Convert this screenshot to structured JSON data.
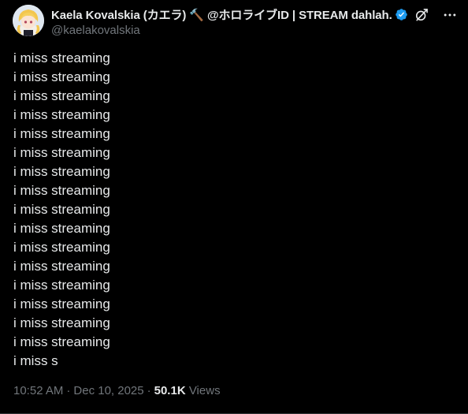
{
  "author": {
    "display_name": "Kaela Kovalskia (カエラ) 🔨 @ホロライブID | STREAM dahlah.",
    "handle": "@kaelakovalskia",
    "verified": true,
    "verified_color": "#1d9bf0",
    "avatar_icon": "avatar-icon"
  },
  "header_actions": {
    "grok_icon": "grok-icon",
    "more_icon": "more-options-icon"
  },
  "post": {
    "lines": [
      "i miss streaming",
      "i miss streaming",
      "i miss streaming",
      "i miss streaming",
      "i miss streaming",
      "i miss streaming",
      "i miss streaming",
      "i miss streaming",
      "i miss streaming",
      "i miss streaming",
      "i miss streaming",
      "i miss streaming",
      "i miss streaming",
      "i miss streaming",
      "i miss streaming",
      "i miss streaming",
      "i miss s"
    ]
  },
  "meta": {
    "time": "10:52 AM",
    "date": "Dec 10, 2025",
    "separator": "·",
    "views_count": "50.1K",
    "views_label": "Views"
  },
  "colors": {
    "background": "#000000",
    "text_primary": "#e7e9ea",
    "text_secondary": "#71767b",
    "accent": "#1d9bf0"
  }
}
